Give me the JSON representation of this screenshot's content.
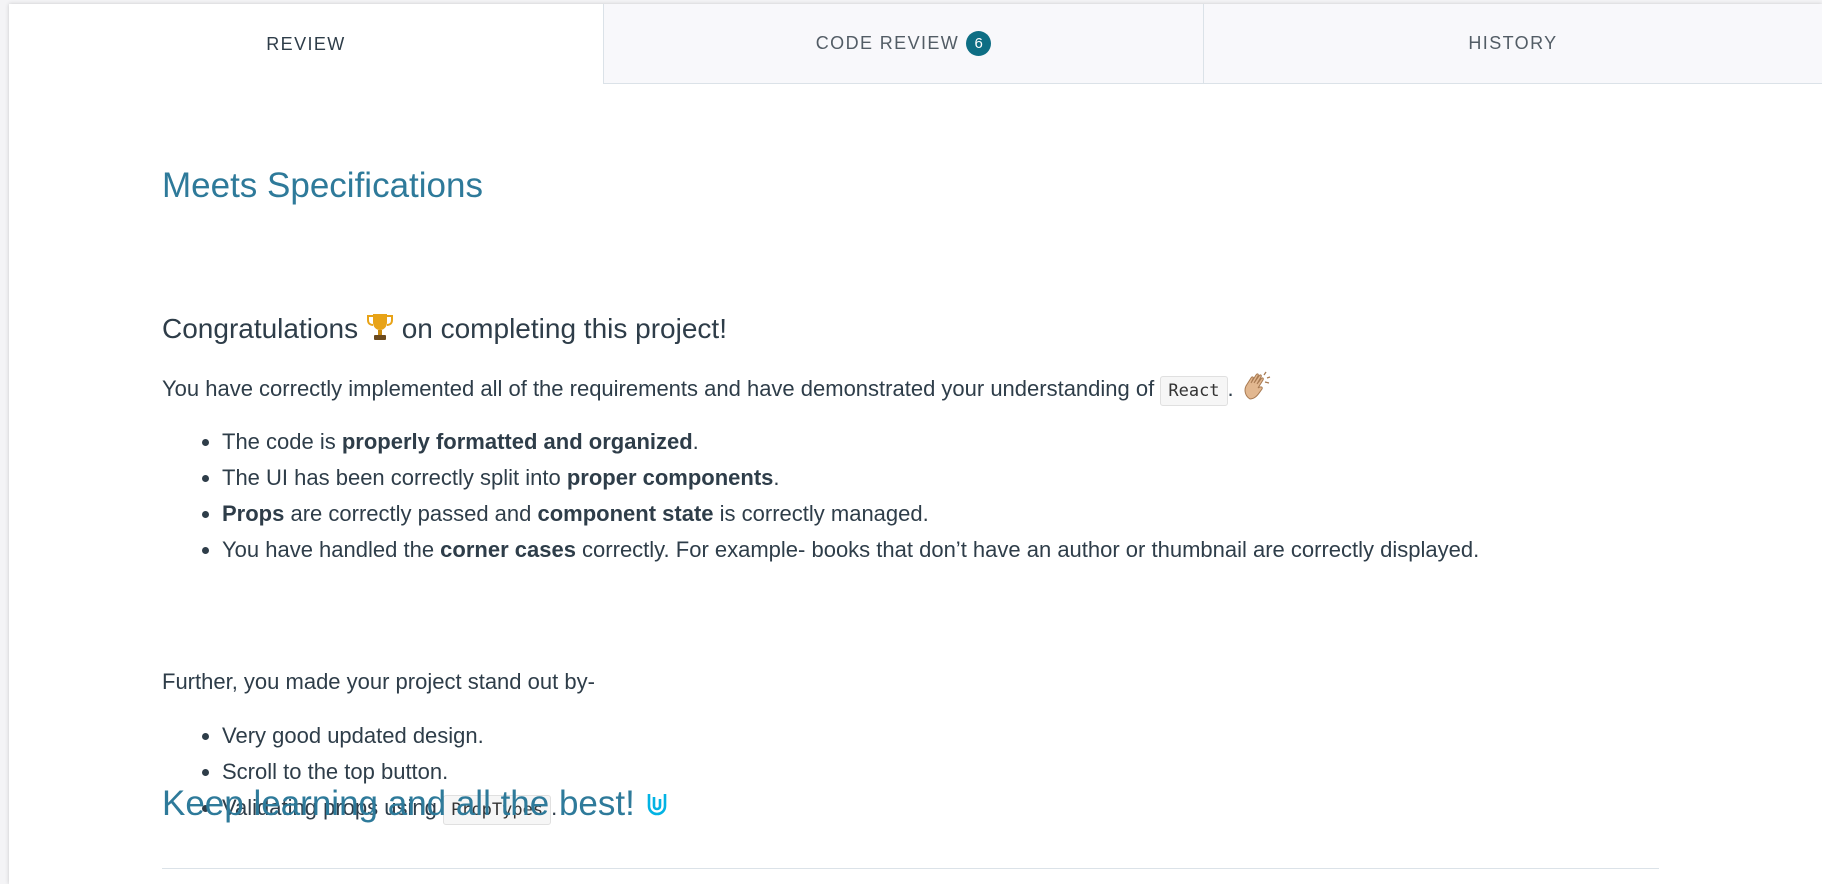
{
  "tabs": {
    "review": "REVIEW",
    "code_review": "CODE REVIEW",
    "code_review_count": "6",
    "history": "HISTORY"
  },
  "review": {
    "result_heading": "Meets Specifications",
    "congrats_before": "Congratulations",
    "congrats_after": "on completing this project!",
    "intro_text": "You have correctly implemented all of the requirements and have demonstrated your understanding of",
    "intro_code": "React",
    "intro_end": ".",
    "bullets1": [
      {
        "a": "The code is ",
        "b": "properly formatted and organized",
        "c": "."
      },
      {
        "a": "The UI has been correctly split into ",
        "b": "proper components",
        "c": "."
      },
      {
        "b1": "Props",
        "a": " are correctly passed and ",
        "b2": "component state",
        "c": " is correctly managed."
      },
      {
        "a": "You have handled the ",
        "b": "corner cases",
        "c": " correctly. For example- books that don’t have an author or thumbnail are correctly displayed."
      }
    ],
    "further_text": "Further, you made your project stand out by-",
    "bullets2": [
      {
        "text": "Very good updated design."
      },
      {
        "text": "Scroll to the top button."
      },
      {
        "a": "Validating props using ",
        "code": "PropTypes",
        "c": "."
      }
    ],
    "closing_heading": "Keep learning and all the best!"
  },
  "icons": {
    "trophy": "trophy-icon",
    "clap": "clapping-hands-icon",
    "udacity": "udacity-logo-icon"
  },
  "colors": {
    "heading_blue": "#2e7a9a",
    "badge": "#0e6e84",
    "logo": "#02b3e4"
  }
}
